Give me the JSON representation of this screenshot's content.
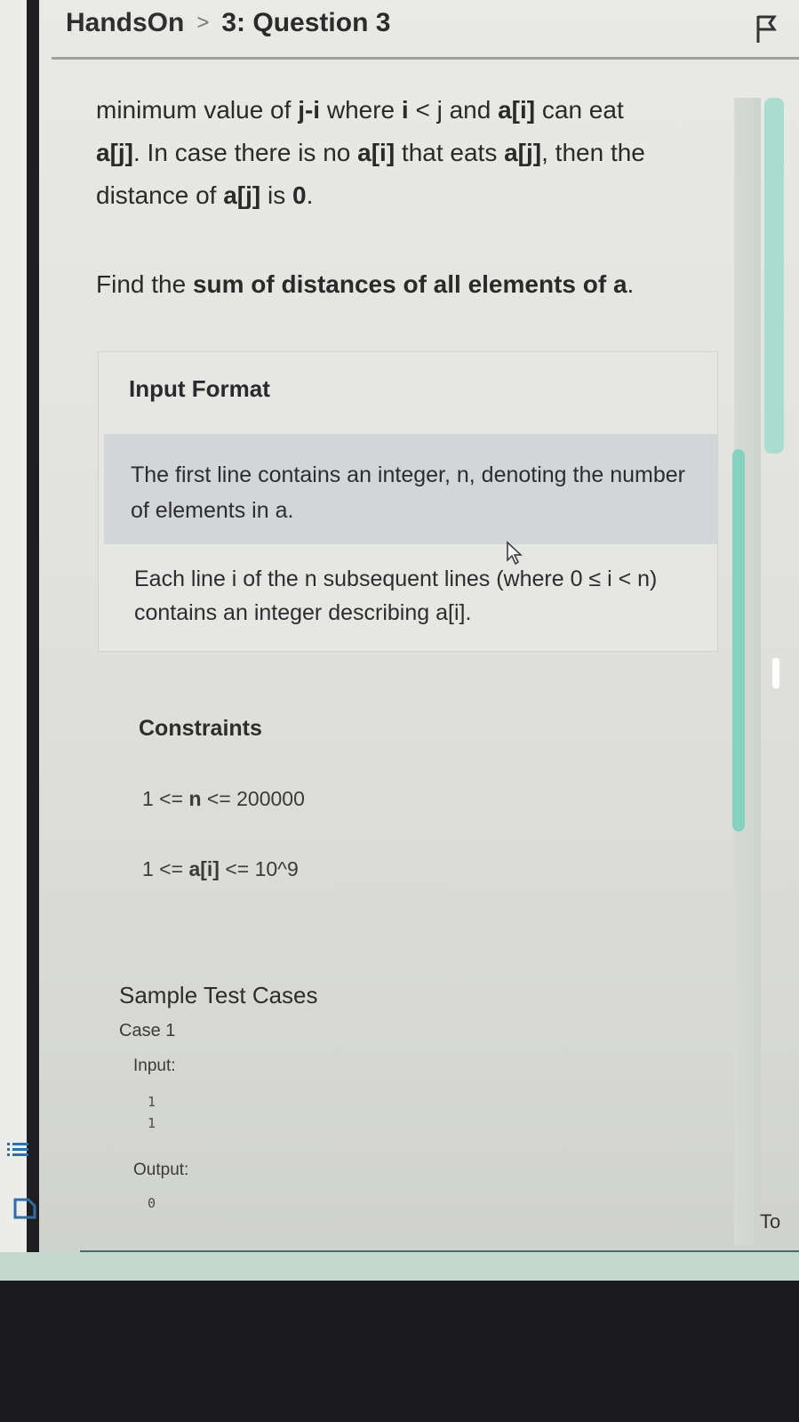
{
  "breadcrumb": {
    "root": "HandsOn",
    "separator": ">",
    "current": "3: Question 3"
  },
  "problem": {
    "intro_lines": [
      {
        "before": "minimum value of ",
        "b1": "j-i",
        "mid1": " where ",
        "b2": "i",
        "mid2": " < j and ",
        "b3": "a[i]",
        "after": " can eat"
      },
      {
        "before": "",
        "b1": "a[j]",
        "mid1": ". In case there is no ",
        "b2": "a[i]",
        "mid2": " that eats ",
        "b3": "a[j]",
        "after": ", then the"
      },
      {
        "before": "distance of ",
        "b1": "a[j]",
        "mid1": " is ",
        "b2": "0",
        "mid2": ".",
        "b3": "",
        "after": ""
      }
    ],
    "find_prefix": "Find the ",
    "find_bold": "sum of distances of all elements of a",
    "find_suffix": "."
  },
  "input_format": {
    "title": "Input Format",
    "line1": "The first line contains an integer, n, denoting the number of elements in a.",
    "line2": "Each line i of the n subsequent lines (where 0 ≤ i < n) contains an integer describing a[i]."
  },
  "constraints": {
    "title": "Constraints",
    "c1_pre": "1 <= ",
    "c1_bold": "n",
    "c1_post": " <= 200000",
    "c2_pre": "1 <= ",
    "c2_bold": "a[i]",
    "c2_post": " <= 10^9"
  },
  "samples": {
    "title": "Sample Test Cases",
    "case_label": "Case 1",
    "input_label": "Input:",
    "input_values": [
      "1",
      "1"
    ],
    "output_label": "Output:",
    "output_value": "0"
  },
  "side": {
    "to_label": "To"
  },
  "colors": {
    "scroll_accent": "#86d2be",
    "bottom_bar": "#c5d8d0"
  },
  "icons": [
    "flag-icon",
    "cursor-icon",
    "list-icon",
    "document-icon"
  ]
}
